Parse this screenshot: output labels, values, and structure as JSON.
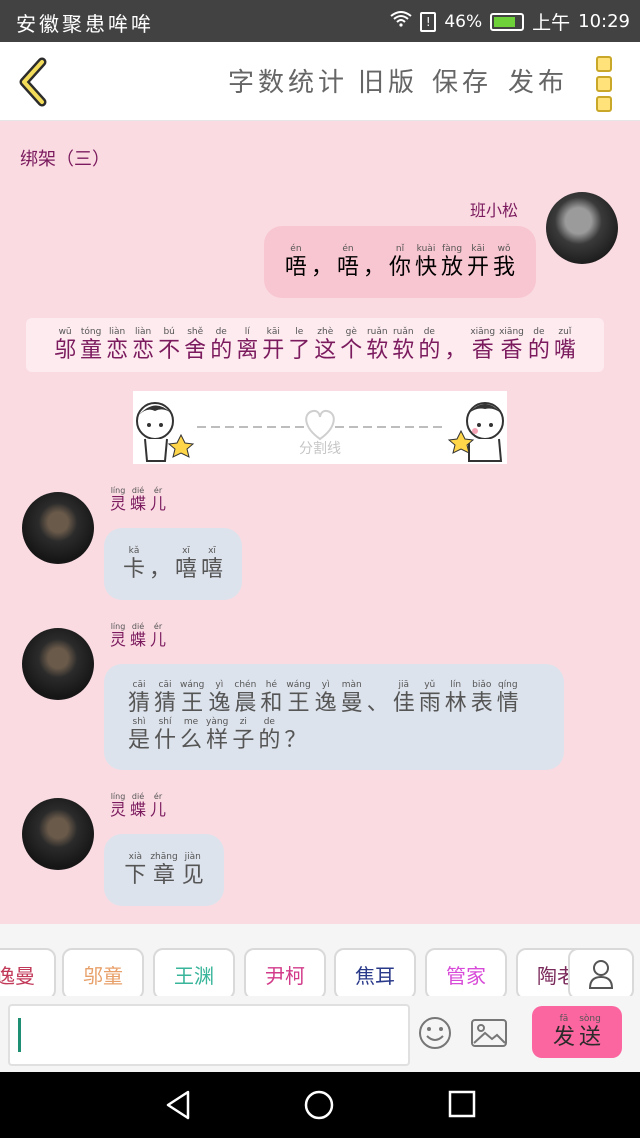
{
  "status": {
    "carrier": "安徽聚患哞哞",
    "battery": "46%",
    "time_period": "上午",
    "time": "10:29"
  },
  "topbar": {
    "menu": [
      {
        "label": "字数统计"
      },
      {
        "label": "旧版"
      },
      {
        "label": "保存"
      },
      {
        "label": "发布"
      }
    ]
  },
  "chapter_title": "绑架（三）",
  "messages": [
    {
      "type": "outgoing",
      "sender": "班小松",
      "text": [
        [
          "唔",
          "én"
        ],
        [
          "，",
          ""
        ],
        [
          "唔",
          "én"
        ],
        [
          "，",
          ""
        ],
        [
          "你",
          "nǐ"
        ],
        [
          "快",
          "kuài"
        ],
        [
          "放",
          "fàng"
        ],
        [
          "开",
          "kāi"
        ],
        [
          "我",
          "wǒ"
        ]
      ]
    },
    {
      "type": "narration",
      "text": [
        [
          "邬",
          "wū"
        ],
        [
          "童",
          "tóng"
        ],
        [
          "恋",
          "liàn"
        ],
        [
          "恋",
          "liàn"
        ],
        [
          "不",
          "bú"
        ],
        [
          "舍",
          "shě"
        ],
        [
          "的",
          "de"
        ],
        [
          "离",
          "lí"
        ],
        [
          "开",
          "kāi"
        ],
        [
          "了",
          "le"
        ],
        [
          "这",
          "zhè"
        ],
        [
          "个",
          "gè"
        ],
        [
          "软",
          "ruǎn"
        ],
        [
          "软",
          "ruǎn"
        ],
        [
          "的",
          "de"
        ],
        [
          "，",
          ""
        ],
        [
          "香",
          "xiāng"
        ],
        [
          "香",
          "xiāng"
        ],
        [
          "的",
          "de"
        ],
        [
          "嘴",
          "zuǐ"
        ]
      ]
    },
    {
      "type": "divider",
      "label": "分割线"
    },
    {
      "type": "incoming",
      "sender": "灵蝶儿",
      "sender_py": [
        [
          "灵",
          "líng"
        ],
        [
          "蝶",
          "dié"
        ],
        [
          "儿",
          "ér"
        ]
      ],
      "text": [
        [
          "卡",
          "kǎ"
        ],
        [
          "，",
          ""
        ],
        [
          "嘻",
          "xī"
        ],
        [
          "嘻",
          "xī"
        ]
      ]
    },
    {
      "type": "incoming",
      "sender": "灵蝶儿",
      "sender_py": [
        [
          "灵",
          "líng"
        ],
        [
          "蝶",
          "dié"
        ],
        [
          "儿",
          "ér"
        ]
      ],
      "line1": [
        [
          "猜",
          "cāi"
        ],
        [
          "猜",
          "cāi"
        ],
        [
          "王",
          "wáng"
        ],
        [
          "逸",
          "yì"
        ],
        [
          "晨",
          "chén"
        ],
        [
          "和",
          "hé"
        ],
        [
          "王",
          "wáng"
        ],
        [
          "逸",
          "yì"
        ],
        [
          "曼",
          "màn"
        ],
        [
          "、",
          ""
        ],
        [
          "佳",
          "jiā"
        ],
        [
          "雨",
          "yǔ"
        ],
        [
          "林",
          "lín"
        ],
        [
          "表",
          "biǎo"
        ],
        [
          "情",
          "qíng"
        ]
      ],
      "line2": [
        [
          "是",
          "shì"
        ],
        [
          "什",
          "shí"
        ],
        [
          "么",
          "me"
        ],
        [
          "样",
          "yàng"
        ],
        [
          "子",
          "zi"
        ],
        [
          "的",
          "de"
        ],
        [
          "？",
          ""
        ]
      ]
    },
    {
      "type": "incoming",
      "sender": "灵蝶儿",
      "sender_py": [
        [
          "灵",
          "líng"
        ],
        [
          "蝶",
          "dié"
        ],
        [
          "儿",
          "ér"
        ]
      ],
      "text": [
        [
          "下",
          "xià"
        ],
        [
          "章",
          "zhāng"
        ],
        [
          "见",
          "jiàn"
        ]
      ]
    }
  ],
  "chips": [
    {
      "label": "逸曼",
      "color": "#c23a5a"
    },
    {
      "label": "邬童",
      "color": "#e8a06a"
    },
    {
      "label": "王渊",
      "color": "#38b59a"
    },
    {
      "label": "尹柯",
      "color": "#d23a8a"
    },
    {
      "label": "焦耳",
      "color": "#2a3a8a"
    },
    {
      "label": "管家",
      "color": "#d84ad8"
    },
    {
      "label": "陶老",
      "color": "#7a2a5a"
    }
  ],
  "input": {
    "placeholder": ""
  },
  "send": {
    "label": "发送",
    "py": [
      [
        "发",
        "fā"
      ],
      [
        "送",
        "sòng"
      ]
    ]
  },
  "icons": {
    "back": "back-chevron-icon",
    "more": "more-icon",
    "emoji": "emoji-icon",
    "image": "image-icon",
    "person": "person-icon"
  }
}
